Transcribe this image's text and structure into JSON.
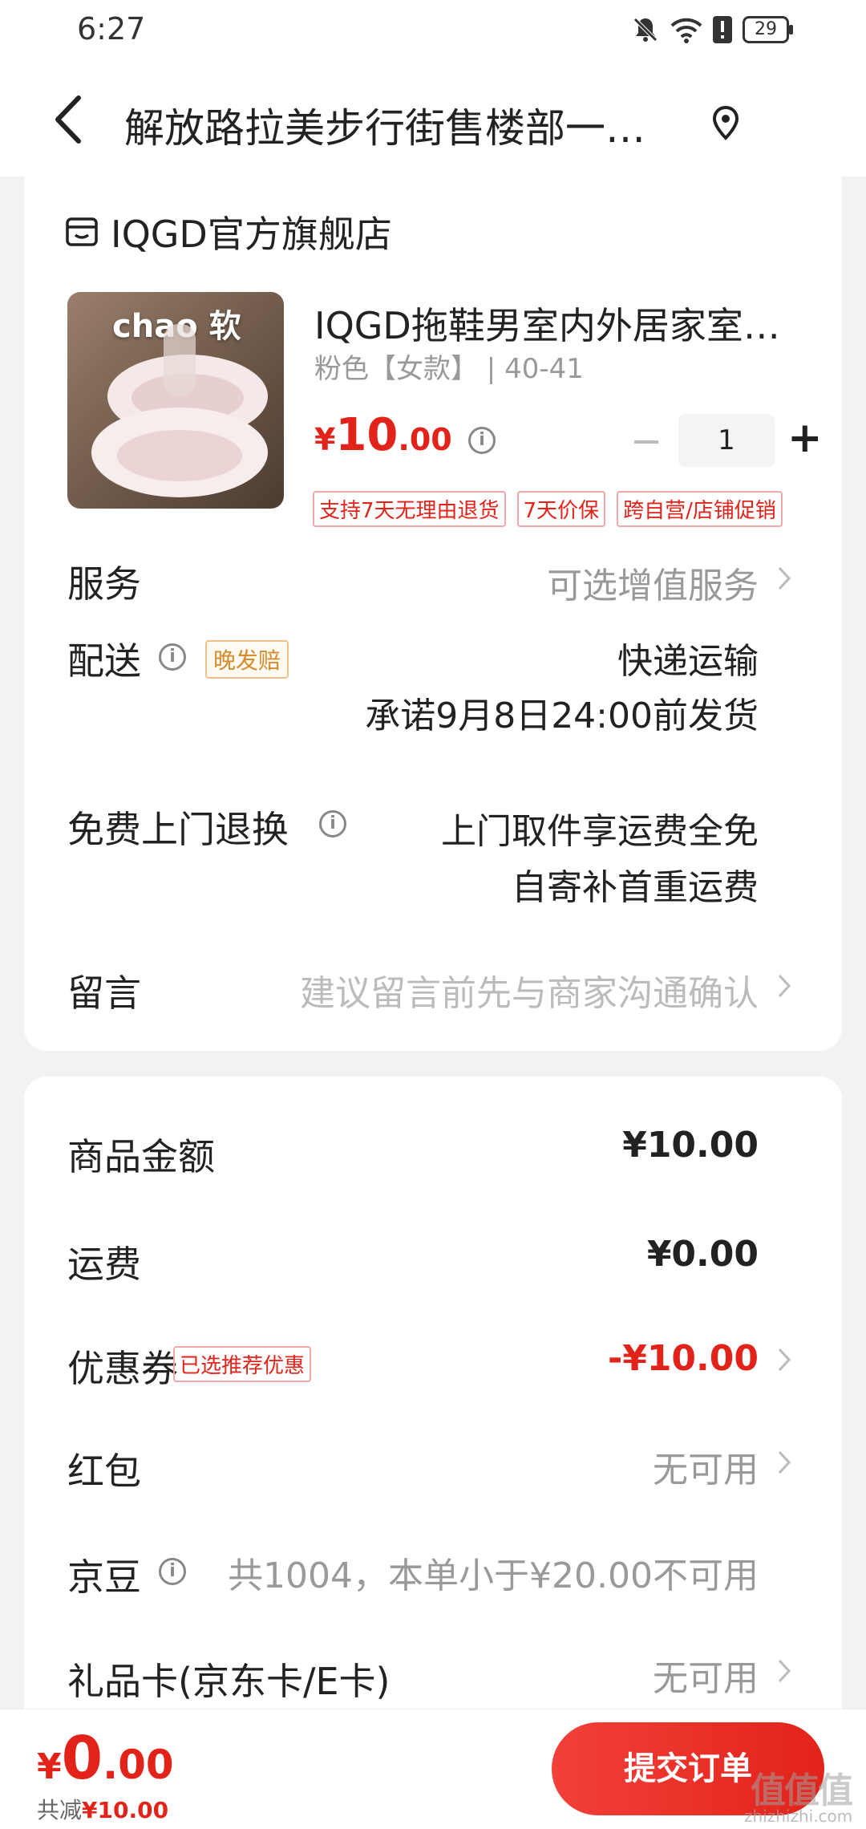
{
  "status": {
    "time": "6:27",
    "battery": "29"
  },
  "nav": {
    "title": "解放路拉美步行街售楼部一…"
  },
  "shop": {
    "name": "IQGD官方旗舰店"
  },
  "product": {
    "image_text": "chao 软",
    "title": "IQGD拖鞋男室内外居家室…",
    "spec": "粉色【女款】 | 40-41",
    "price_yen": "¥",
    "price_int": "10",
    "price_dec": ".00",
    "qty": "1",
    "qty_minus": "−",
    "qty_plus": "+",
    "tags": [
      "支持7天无理由退货",
      "7天价保",
      "跨自营/店铺促销"
    ]
  },
  "service": {
    "label": "服务",
    "value": "可选增值服务"
  },
  "delivery": {
    "label": "配送",
    "badge": "晚发赔",
    "method": "快递运输",
    "promise": "承诺9月8日24:00前发货"
  },
  "return": {
    "label": "免费上门退换",
    "line1": "上门取件享运费全免",
    "line2": "自寄补首重运费"
  },
  "message": {
    "label": "留言",
    "placeholder": "建议留言前先与商家沟通确认"
  },
  "summary": {
    "goods_label": "商品金额",
    "goods_value": "¥10.00",
    "shipping_label": "运费",
    "shipping_value": "¥0.00",
    "coupon_label": "优惠券",
    "coupon_badge": "已选推荐优惠",
    "coupon_value": "-¥10.00",
    "redpacket_label": "红包",
    "redpacket_value": "无可用",
    "jingdou_label": "京豆",
    "jingdou_value": "共1004，本单小于¥20.00不可用",
    "giftcard_label": "礼品卡(京东卡/E卡)",
    "giftcard_value": "无可用"
  },
  "bottom": {
    "total_yen": "¥",
    "total_int": "0",
    "total_dec": ".00",
    "saved_prefix": "共减",
    "saved_value": "¥10.00",
    "submit": "提交订单"
  },
  "watermark": {
    "main": "值值值",
    "sub": "zhizhizhi.com"
  },
  "colors": {
    "accent": "#e2231a",
    "badge_orange": "#d98b2b"
  }
}
